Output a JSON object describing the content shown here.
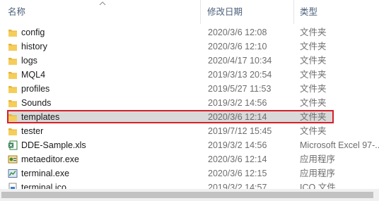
{
  "header": {
    "name_label": "名称",
    "date_label": "修改日期",
    "type_label": "类型",
    "sort_icon": "chevron-up-icon"
  },
  "rows": [
    {
      "icon": "folder-icon",
      "name": "config",
      "date": "2020/3/6 12:08",
      "type": "文件夹"
    },
    {
      "icon": "folder-icon",
      "name": "history",
      "date": "2020/3/6 12:10",
      "type": "文件夹"
    },
    {
      "icon": "folder-icon",
      "name": "logs",
      "date": "2020/4/17 10:34",
      "type": "文件夹"
    },
    {
      "icon": "folder-icon",
      "name": "MQL4",
      "date": "2019/3/13 20:54",
      "type": "文件夹"
    },
    {
      "icon": "folder-icon",
      "name": "profiles",
      "date": "2019/5/27 11:53",
      "type": "文件夹"
    },
    {
      "icon": "folder-icon",
      "name": "Sounds",
      "date": "2019/3/2 14:56",
      "type": "文件夹"
    },
    {
      "icon": "folder-icon",
      "name": "templates",
      "date": "2020/3/6 12:14",
      "type": "文件夹",
      "selected": true
    },
    {
      "icon": "folder-icon",
      "name": "tester",
      "date": "2019/7/12 15:45",
      "type": "文件夹"
    },
    {
      "icon": "excel-file-icon",
      "name": "DDE-Sample.xls",
      "date": "2019/3/2 14:56",
      "type": "Microsoft Excel 97-..."
    },
    {
      "icon": "metaeditor-app-icon",
      "name": "metaeditor.exe",
      "date": "2020/3/6 12:14",
      "type": "应用程序"
    },
    {
      "icon": "terminal-app-icon",
      "name": "terminal.exe",
      "date": "2020/3/6 12:15",
      "type": "应用程序"
    },
    {
      "icon": "ico-file-icon",
      "name": "terminal.ico",
      "date": "2019/3/2 14:57",
      "type": "ICO 文件"
    }
  ],
  "colors": {
    "selection_bg": "#d9d9d9",
    "highlight_border": "#d4202a",
    "folder": "#f0c04a",
    "header_text": "#4c607a",
    "meta_text": "#6d6d6d"
  }
}
